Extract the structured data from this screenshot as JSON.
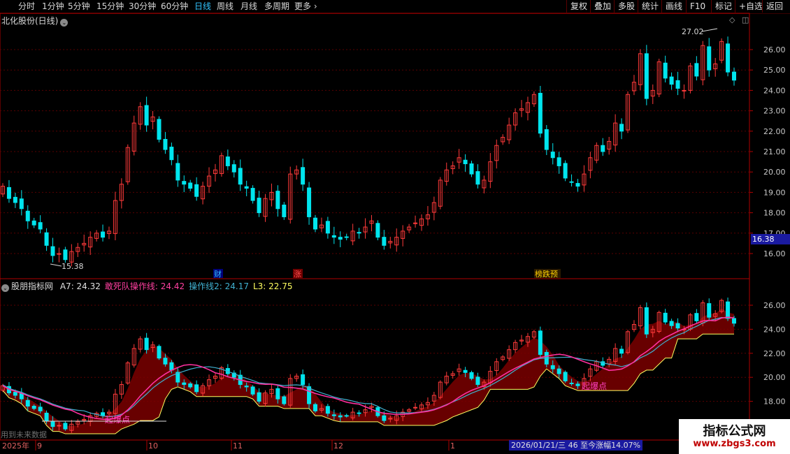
{
  "toolbar": {
    "periods": [
      "分时",
      "1分钟",
      "5分钟",
      "15分钟",
      "30分钟",
      "60分钟",
      "日线",
      "周线",
      "月线",
      "多周期",
      "更多"
    ],
    "active": "日线",
    "more_icon": "chevron-right-icon",
    "right_buttons": [
      "复权",
      "叠加",
      "多股",
      "统计",
      "画线",
      "F10",
      "标记",
      "+自选",
      "返回"
    ]
  },
  "main": {
    "title": "北化股份(日线)",
    "title_icon": "chevron-down-icon",
    "high_label": "27.02",
    "low_label": "15.38",
    "current_price": "16.38",
    "y_ticks": [
      "26.00",
      "25.00",
      "24.00",
      "23.00",
      "22.00",
      "21.00",
      "20.00",
      "19.00",
      "18.00",
      "17.00",
      "16.00"
    ],
    "markers": [
      {
        "text": "财",
        "color": "#31c4ff",
        "bg": "#00007a"
      },
      {
        "text": "涨",
        "color": "#ff5050",
        "bg": "#700000"
      },
      {
        "text": "榜跌预",
        "color": "#ffd000",
        "bg": "#2a1a00"
      }
    ]
  },
  "indicator": {
    "name": "股朋指标网",
    "values": [
      {
        "label": "A7: 24.32",
        "color": "#e0e0e0"
      },
      {
        "label": "敢死队操作线: 24.42",
        "color": "#ff40a0"
      },
      {
        "label": "操作线2: 24.17",
        "color": "#40b0d0"
      },
      {
        "label": "L3: 22.75",
        "color": "#ffff60"
      }
    ],
    "y_ticks": [
      "26.00",
      "24.00",
      "22.00",
      "20.00",
      "18.00"
    ],
    "signal_labels": [
      "起爆点",
      "起爆点"
    ],
    "note": "用到未来数据"
  },
  "x_axis": {
    "labels": [
      "2025年",
      "9",
      "10",
      "11",
      "12",
      "1"
    ]
  },
  "status_bar": "2026/01/21/三  46 至今涨幅14.07%",
  "watermark": {
    "title": "指标公式网",
    "url": "www.zbgs3.com"
  },
  "colors": {
    "up": "#ff3a3a",
    "down": "#00e5ee",
    "grid": "#5a0000",
    "border": "#b00000",
    "ma_pink": "#ff30a0",
    "ma_cyan": "#40b0d0",
    "l3_yellow": "#ffff60",
    "cloud": "#7a0000"
  },
  "chart_data": {
    "type": "candlestick",
    "series_closes": [
      19.3,
      18.7,
      18.5,
      18.2,
      17.6,
      17.4,
      17.2,
      16.4,
      15.9,
      16.0,
      15.7,
      16.1,
      16.3,
      16.5,
      16.8,
      17.0,
      16.8,
      17.1,
      18.6,
      19.4,
      21.2,
      22.4,
      23.2,
      22.3,
      22.7,
      21.6,
      21.1,
      20.6,
      19.6,
      19.4,
      19.2,
      18.8,
      19.3,
      19.8,
      20.1,
      20.8,
      20.3,
      20.0,
      19.4,
      19.2,
      18.6,
      18.0,
      18.7,
      19.0,
      18.2,
      17.8,
      19.9,
      20.1,
      19.4,
      17.8,
      17.2,
      17.4,
      17.0,
      16.8,
      16.7,
      16.8,
      17.1,
      17.0,
      17.3,
      17.6,
      16.8,
      16.4,
      16.6,
      16.8,
      17.1,
      17.3,
      17.5,
      17.7,
      17.9,
      18.5,
      19.6,
      20.1,
      20.3,
      20.7,
      20.4,
      19.9,
      19.4,
      19.6,
      20.5,
      21.3,
      21.7,
      22.3,
      22.9,
      23.1,
      23.4,
      23.8,
      21.9,
      21.1,
      20.7,
      20.3,
      19.7,
      19.5,
      19.3,
      19.9,
      20.7,
      21.3,
      21.0,
      21.5,
      22.4,
      22.0,
      23.8,
      24.4,
      25.8,
      23.6,
      24.0,
      25.4,
      24.6,
      24.3,
      24.1,
      24.0,
      25.2,
      24.7,
      26.2,
      25.0,
      25.3,
      26.4,
      24.9,
      24.5
    ],
    "high": 27.02,
    "low": 15.38,
    "indicator_lines": {
      "ops_line": "pink moving line",
      "ops_line2": "cyan moving line",
      "L3": "yellow stepped line"
    }
  }
}
